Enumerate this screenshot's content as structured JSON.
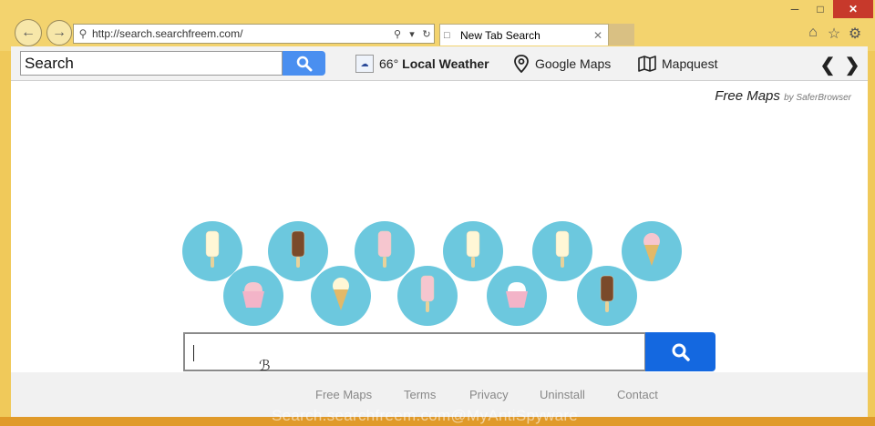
{
  "browser": {
    "url": "http://search.searchfreem.com/",
    "tab_title": "New Tab Search",
    "controls": {
      "minimize": "─",
      "maximize": "□",
      "close": "✕"
    }
  },
  "toolbar": {
    "search_value": "Search",
    "weather": {
      "temp": "66°",
      "label": "Local Weather"
    },
    "google_maps": "Google Maps",
    "mapquest": "Mapquest"
  },
  "page": {
    "brand": "Free Maps",
    "brand_by": "by SaferBrowser",
    "bubbles": [
      {
        "icon": "popsicle-vanilla-icon",
        "color": "#fff7d6"
      },
      {
        "icon": "popsicle-chocolate-icon",
        "color": "#7a4a2a"
      },
      {
        "icon": "popsicle-pink-icon",
        "color": "#f6c6cf"
      },
      {
        "icon": "popsicle-vanilla-icon",
        "color": "#fff7d6"
      },
      {
        "icon": "popsicle-vanilla-icon",
        "color": "#fff7d6"
      },
      {
        "icon": "ice-cream-cone-icon",
        "color": "#f6c6cf"
      },
      {
        "icon": "cupcake-icon",
        "color": "#f6c6cf"
      },
      {
        "icon": "ice-cream-cone-icon",
        "color": "#fff7d6"
      },
      {
        "icon": "popsicle-pink-icon",
        "color": "#f6c6cf"
      },
      {
        "icon": "cupcake-icon",
        "color": "#ffffff"
      },
      {
        "icon": "popsicle-chocolate-icon",
        "color": "#7a4a2a"
      }
    ],
    "main_search_value": ""
  },
  "footer": {
    "links": [
      "Free Maps",
      "Terms",
      "Privacy",
      "Uninstall",
      "Contact"
    ]
  },
  "watermark": "Search.searchfreem.com@MyAntiSpyware",
  "colors": {
    "frame": "#f0c95a",
    "search_button": "#1468e0",
    "toolbar_search_button": "#4a8ff0",
    "bubble": "#6cc8de"
  }
}
